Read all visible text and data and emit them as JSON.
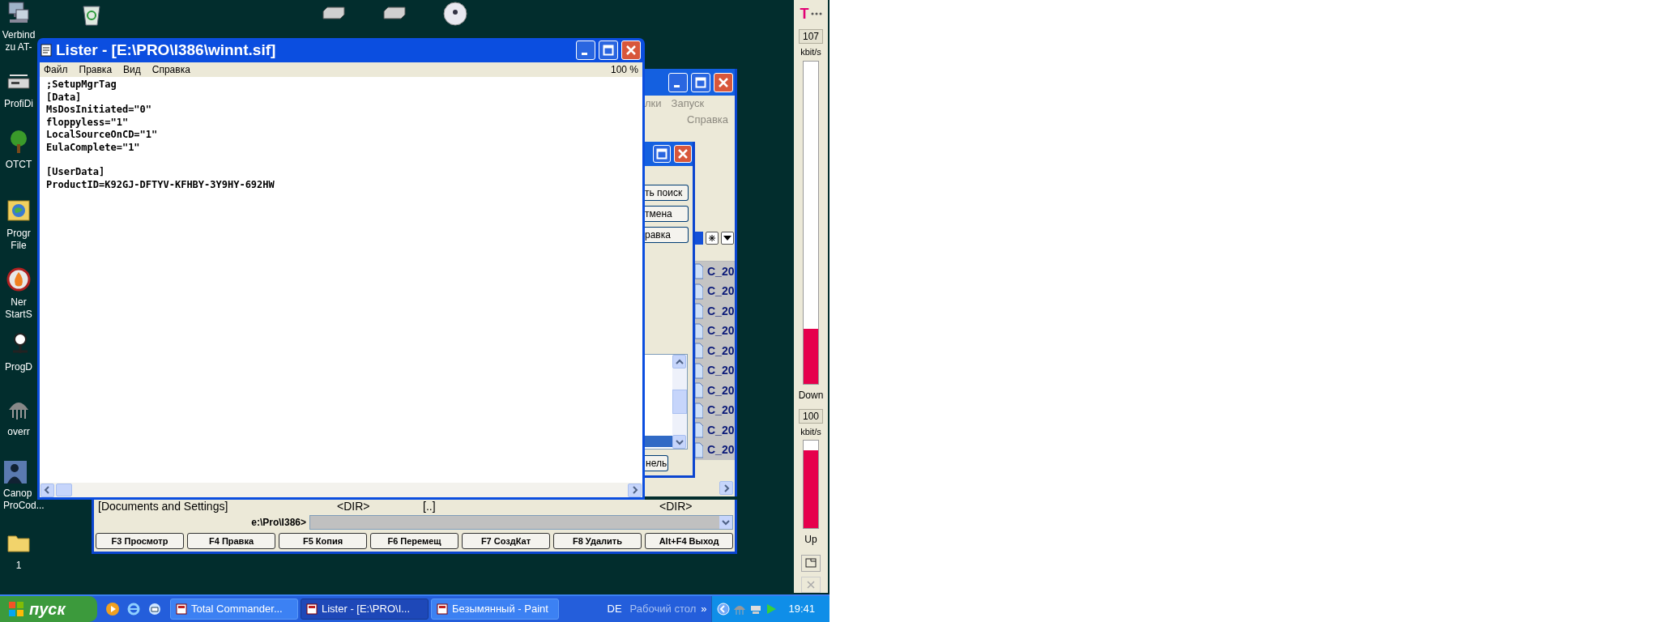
{
  "desktop_icons": [
    {
      "kind": "monitor",
      "label_lines": [
        "Verbind",
        "zu AT-"
      ]
    },
    {
      "kind": "device",
      "label_lines": [
        "ProfiDi"
      ]
    },
    {
      "kind": "tree",
      "label_lines": [
        "OTCT"
      ]
    },
    {
      "kind": "globe",
      "label_lines": [
        "Progr",
        "File"
      ]
    },
    {
      "kind": "flame",
      "label_lines": [
        "Ner",
        "StartS"
      ]
    },
    {
      "kind": "figure",
      "label_lines": [
        "ProgD"
      ]
    },
    {
      "kind": "jellyfish",
      "label_lines": [
        "overr"
      ]
    },
    {
      "kind": "silhouette",
      "label_lines": [
        "Canop",
        "ProCod..."
      ]
    },
    {
      "kind": "folder",
      "label_lines": [
        "1"
      ]
    }
  ],
  "lister": {
    "title": "Lister - [E:\\PRO\\I386\\winnt.sif]",
    "menu": [
      "Файл",
      "Правка",
      "Вид",
      "Справка"
    ],
    "zoom": "100 %",
    "blocks": [
      [
        ";SetupMgrTag",
        "[Data]",
        "MsDosInitiated=\"0\"",
        "floppyless=\"1\"",
        "LocalSourceOnCD=\"1\"",
        "EulaComplete=\"1\""
      ],
      [
        "[UserData]",
        "ProductID=K92GJ-DFTYV-KFHBY-3Y9HY-692HW"
      ]
    ]
  },
  "total_commander": {
    "menu": [
      "лки",
      "Запуск",
      "Справка"
    ],
    "file_names": [
      "C_20",
      "C_20",
      "C_20",
      "C_20",
      "C_20",
      "C_20",
      "C_20",
      "C_20",
      "C_20",
      "C_20"
    ],
    "bottom_row": [
      "[Documents and Settings]",
      "<DIR>",
      "[..]",
      "<DIR>"
    ],
    "path": "e:\\Pro\\I386>",
    "function_keys": [
      "F3 Просмотр",
      "F4 Правка",
      "F5 Копия",
      "F6 Перемещ",
      "F7 СоздКат",
      "F8 Удалить",
      "Alt+F4 Выход"
    ]
  },
  "find_dialog": {
    "buttons": [
      "ть поиск",
      "тмена",
      "равка"
    ],
    "bottom_button": "нель"
  },
  "meter": {
    "logo": "T",
    "down": {
      "reading": "107",
      "unit": "kbit/s",
      "level": 0.17,
      "label": "Down"
    },
    "up": {
      "reading": "100",
      "unit": "kbit/s",
      "level": 0.89,
      "label": "Up"
    }
  },
  "taskbar": {
    "start": "пуск",
    "tasks": [
      {
        "label": "Total Commander...",
        "selected": false
      },
      {
        "label": "Lister - [E:\\PRO\\I...",
        "selected": true
      },
      {
        "label": "Безымянный - Paint",
        "selected": false
      }
    ],
    "language": "DE",
    "toolbar": "Рабочий стол",
    "chevron": "»",
    "clock": "19:41"
  }
}
